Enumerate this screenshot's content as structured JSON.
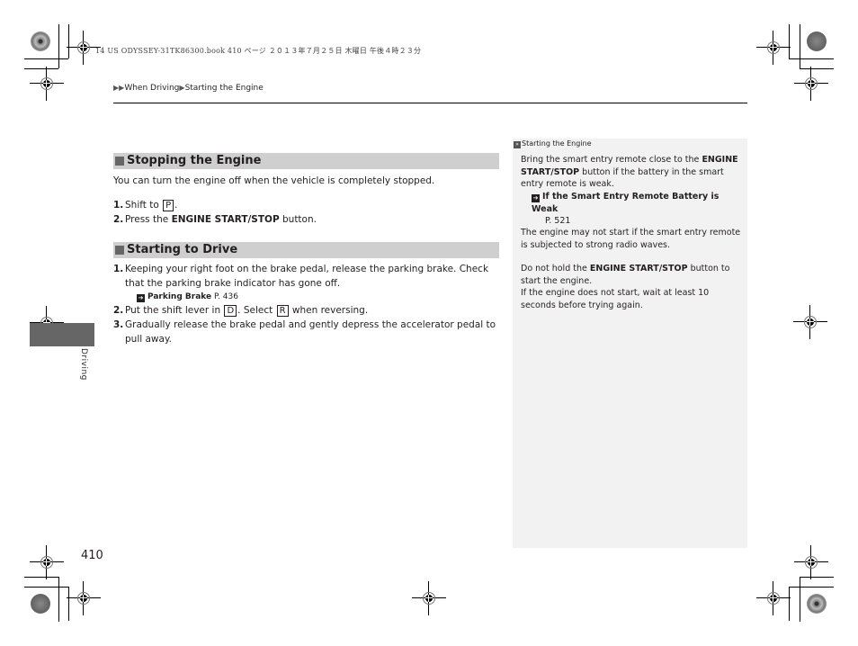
{
  "print_header": {
    "text": "14 US ODYSSEY-31TK86300.book  410 ページ  ２０１３年７月２５日  木曜日  午後４時２３分"
  },
  "breadcrumb": {
    "separator": "▶",
    "items": [
      "When Driving",
      "Starting the Engine"
    ]
  },
  "sections": [
    {
      "title": "Stopping the Engine",
      "intro": "You can turn the engine off when the vehicle is completely stopped.",
      "steps": [
        {
          "num": "1.",
          "pre": "Shift to",
          "key": "P",
          "post": "."
        },
        {
          "num": "2.",
          "pre": "Press the",
          "bold": "ENGINE START/STOP",
          "post": "button."
        }
      ]
    },
    {
      "title": "Starting to Drive",
      "steps": [
        {
          "num": "1.",
          "text": "Keeping your right foot on the brake pedal, release the parking brake. Check that the parking brake indicator has gone off.",
          "xref": {
            "title": "Parking Brake",
            "page": "P. 436"
          }
        },
        {
          "num": "2.",
          "pre": "Put the shift lever in",
          "key": "D",
          "mid": ". Select",
          "key2": "R",
          "post": "when reversing."
        },
        {
          "num": "3.",
          "text": "Gradually release the brake pedal and gently depress the accelerator pedal to pull away."
        }
      ]
    }
  ],
  "sidebar": {
    "heading": "Starting the Engine",
    "para1": {
      "pre": "Bring the smart entry remote close to the",
      "bold": "ENGINE START/STOP",
      "post": "button if the battery in the smart entry remote is weak."
    },
    "xref": {
      "title": "If the Smart Entry Remote Battery is Weak",
      "page": "P. 521"
    },
    "para2": "The engine may not start if the smart entry remote is subjected to strong radio waves.",
    "para3": {
      "pre": "Do not hold the",
      "bold": "ENGINE START/STOP",
      "post": "button to start the engine."
    },
    "para4": "If the engine does not start, wait at least 10 seconds before trying again."
  },
  "chapter_tab": {
    "label": "Driving",
    "color": "#666666"
  },
  "page_number": "410",
  "colors": {
    "section_bar": "#cfcfcf",
    "sidebar_bg": "#f2f2f2",
    "text": "#231f20"
  }
}
